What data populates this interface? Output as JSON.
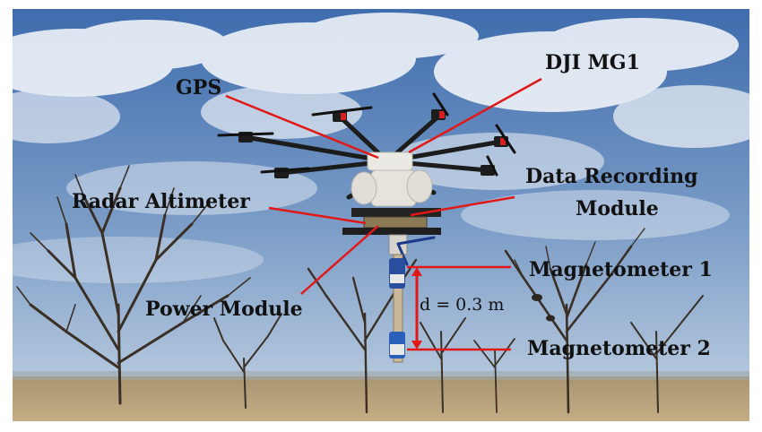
{
  "labels": {
    "gps": "GPS",
    "dji_mg1": "DJI MG1",
    "data_recording_line1": "Data Recording",
    "data_recording_line2": "Module",
    "radar_altimeter": "Radar Altimeter",
    "magnetometer_1": "Magnetometer 1",
    "power_module": "Power Module",
    "distance": "d = 0.3 m",
    "magnetometer_2": "Magnetometer 2"
  },
  "colors": {
    "leader_line": "#e01818",
    "sky_top": "#3f6fb0",
    "sky_bottom": "#b7cbe0",
    "ground": "#b59e76",
    "drone_body": "#e9e7e2",
    "drone_frame": "#1c1c1c",
    "motor_accent": "#d42020"
  }
}
